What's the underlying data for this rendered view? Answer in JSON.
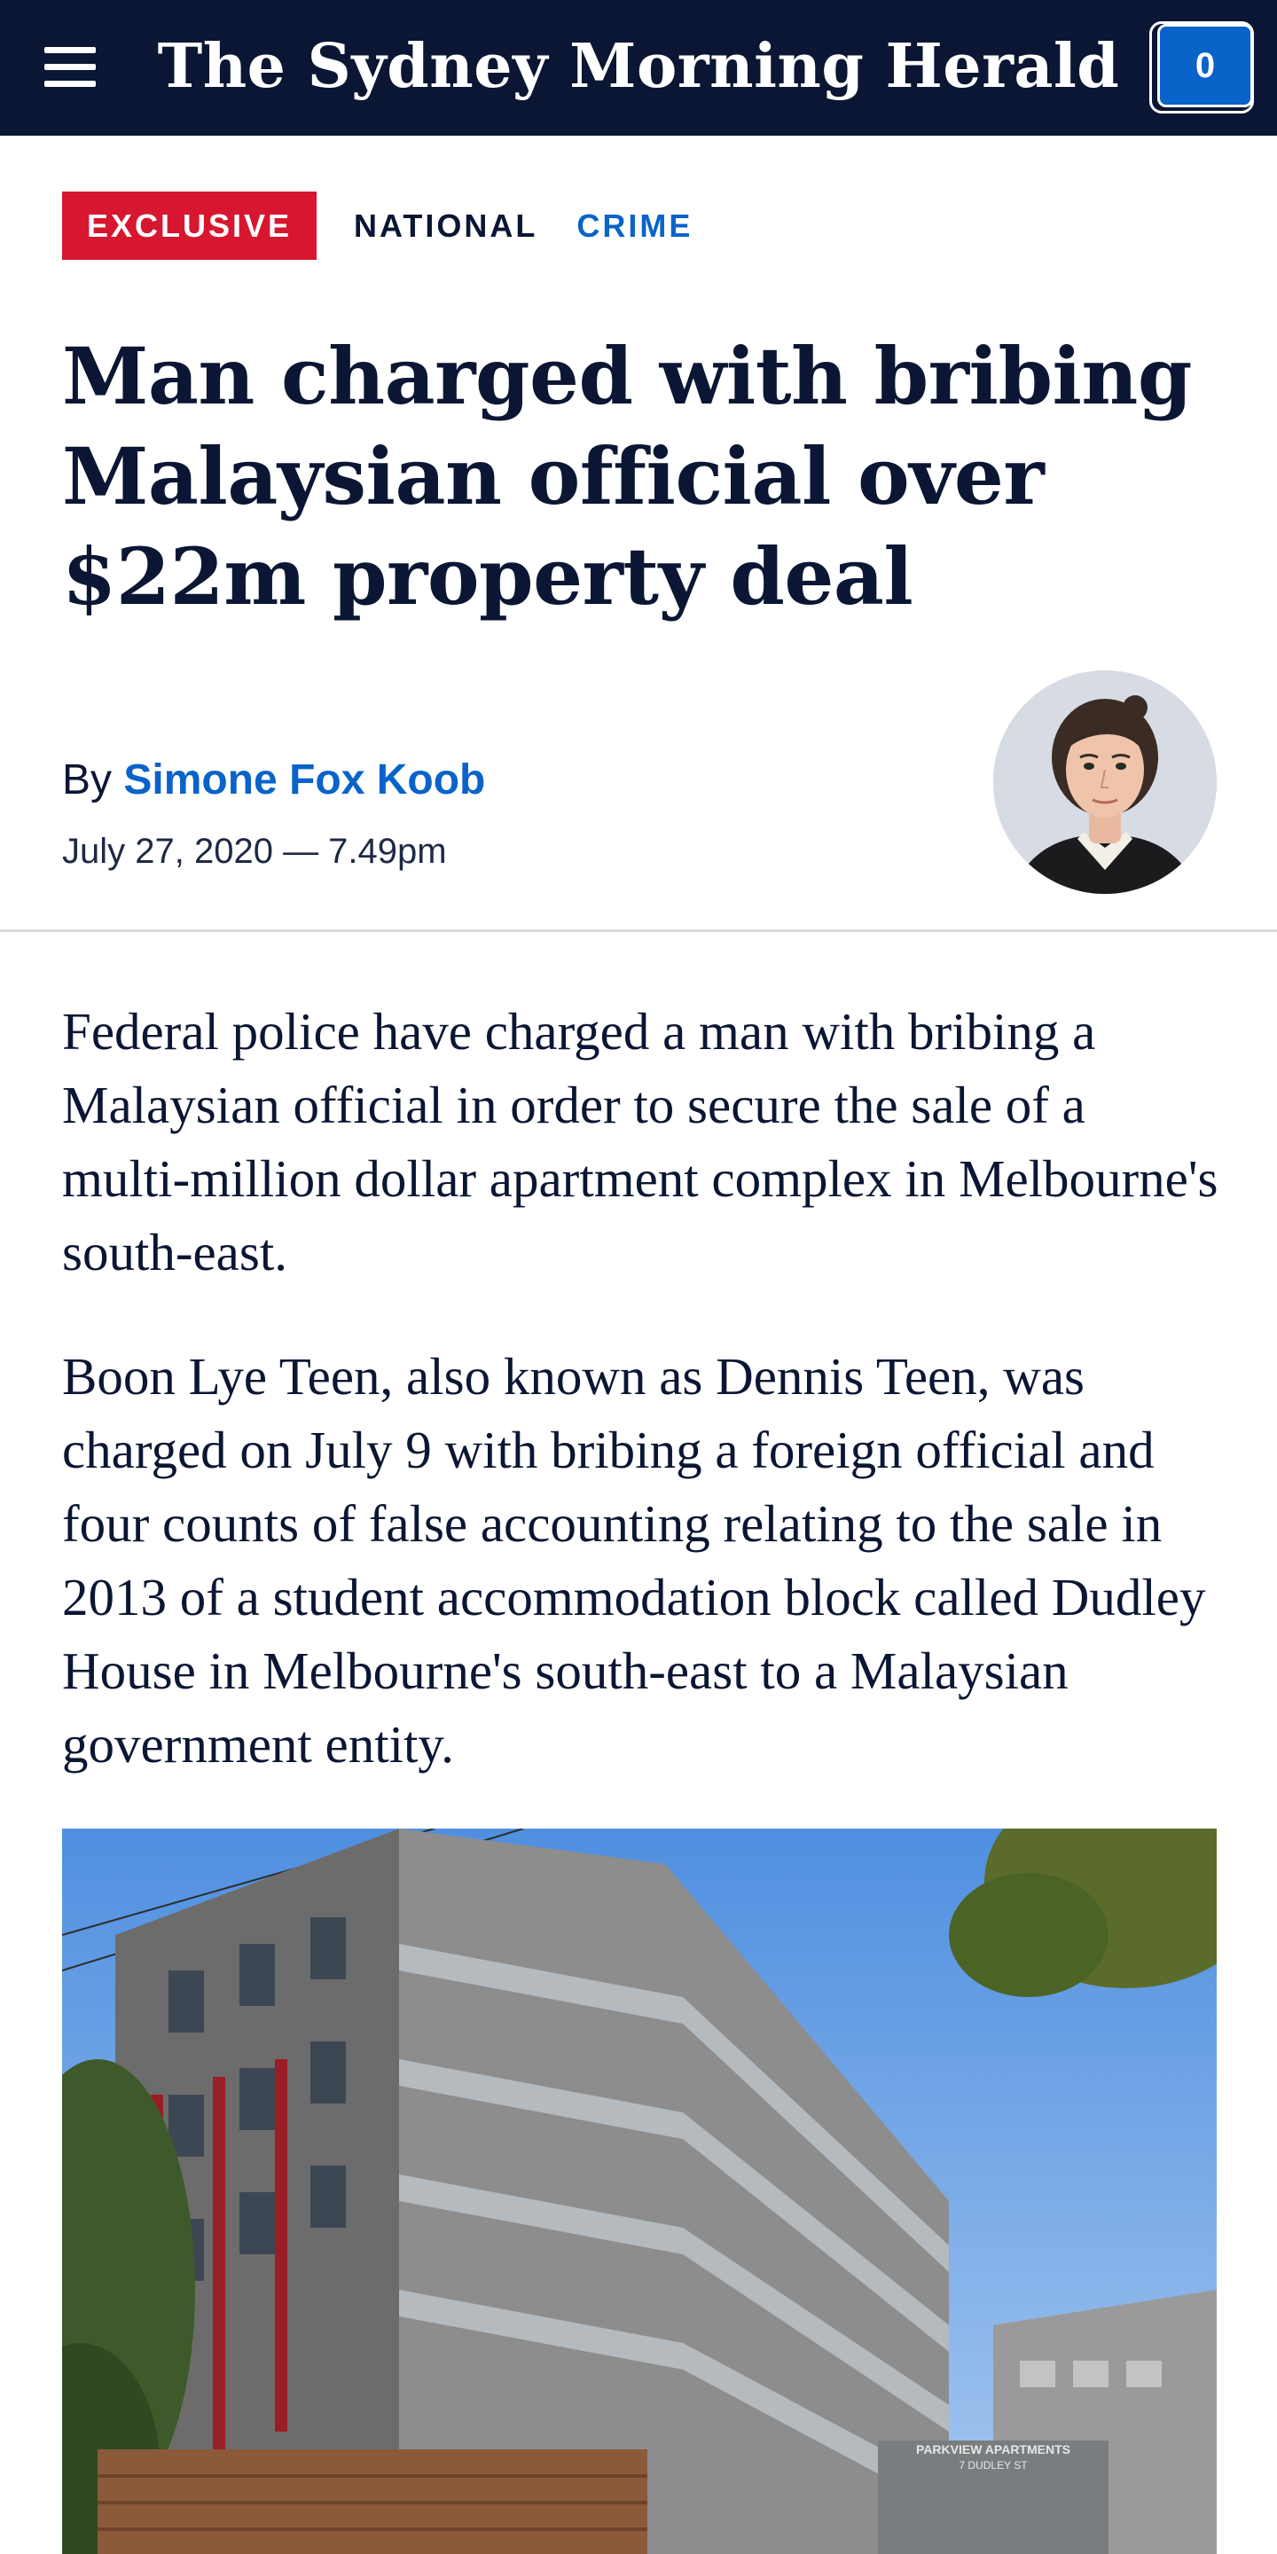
{
  "header": {
    "masthead": "The Sydney Morning Herald",
    "count": "0"
  },
  "tags": {
    "exclusive": "EXCLUSIVE",
    "national": "NATIONAL",
    "crime": "CRIME"
  },
  "article": {
    "headline": "Man charged with bribing Malaysian official over $22m property deal",
    "byline_prefix": "By",
    "author": "Simone Fox Koob",
    "date": "July 27, 2020 — 7.49pm",
    "paragraphs": [
      "Federal police have charged a man with bribing a Malaysian official in order to secure the sale of a multi-million dollar apartment complex in Melbourne's south-east.",
      "Boon Lye Teen, also known as Dennis Teen, was charged on July 9 with bribing a foreign official and four counts of false accounting relating to the sale in 2013 of a student accommodation block called Dudley House in Melbourne's south-east to a Malaysian government entity."
    ],
    "photo_sign": "PARKVIEW APARTMENTS\n7 DUDLEY ST"
  },
  "colors": {
    "navy": "#0a1633",
    "accent_blue": "#0a63c9",
    "exclusive_red": "#d6172f"
  }
}
